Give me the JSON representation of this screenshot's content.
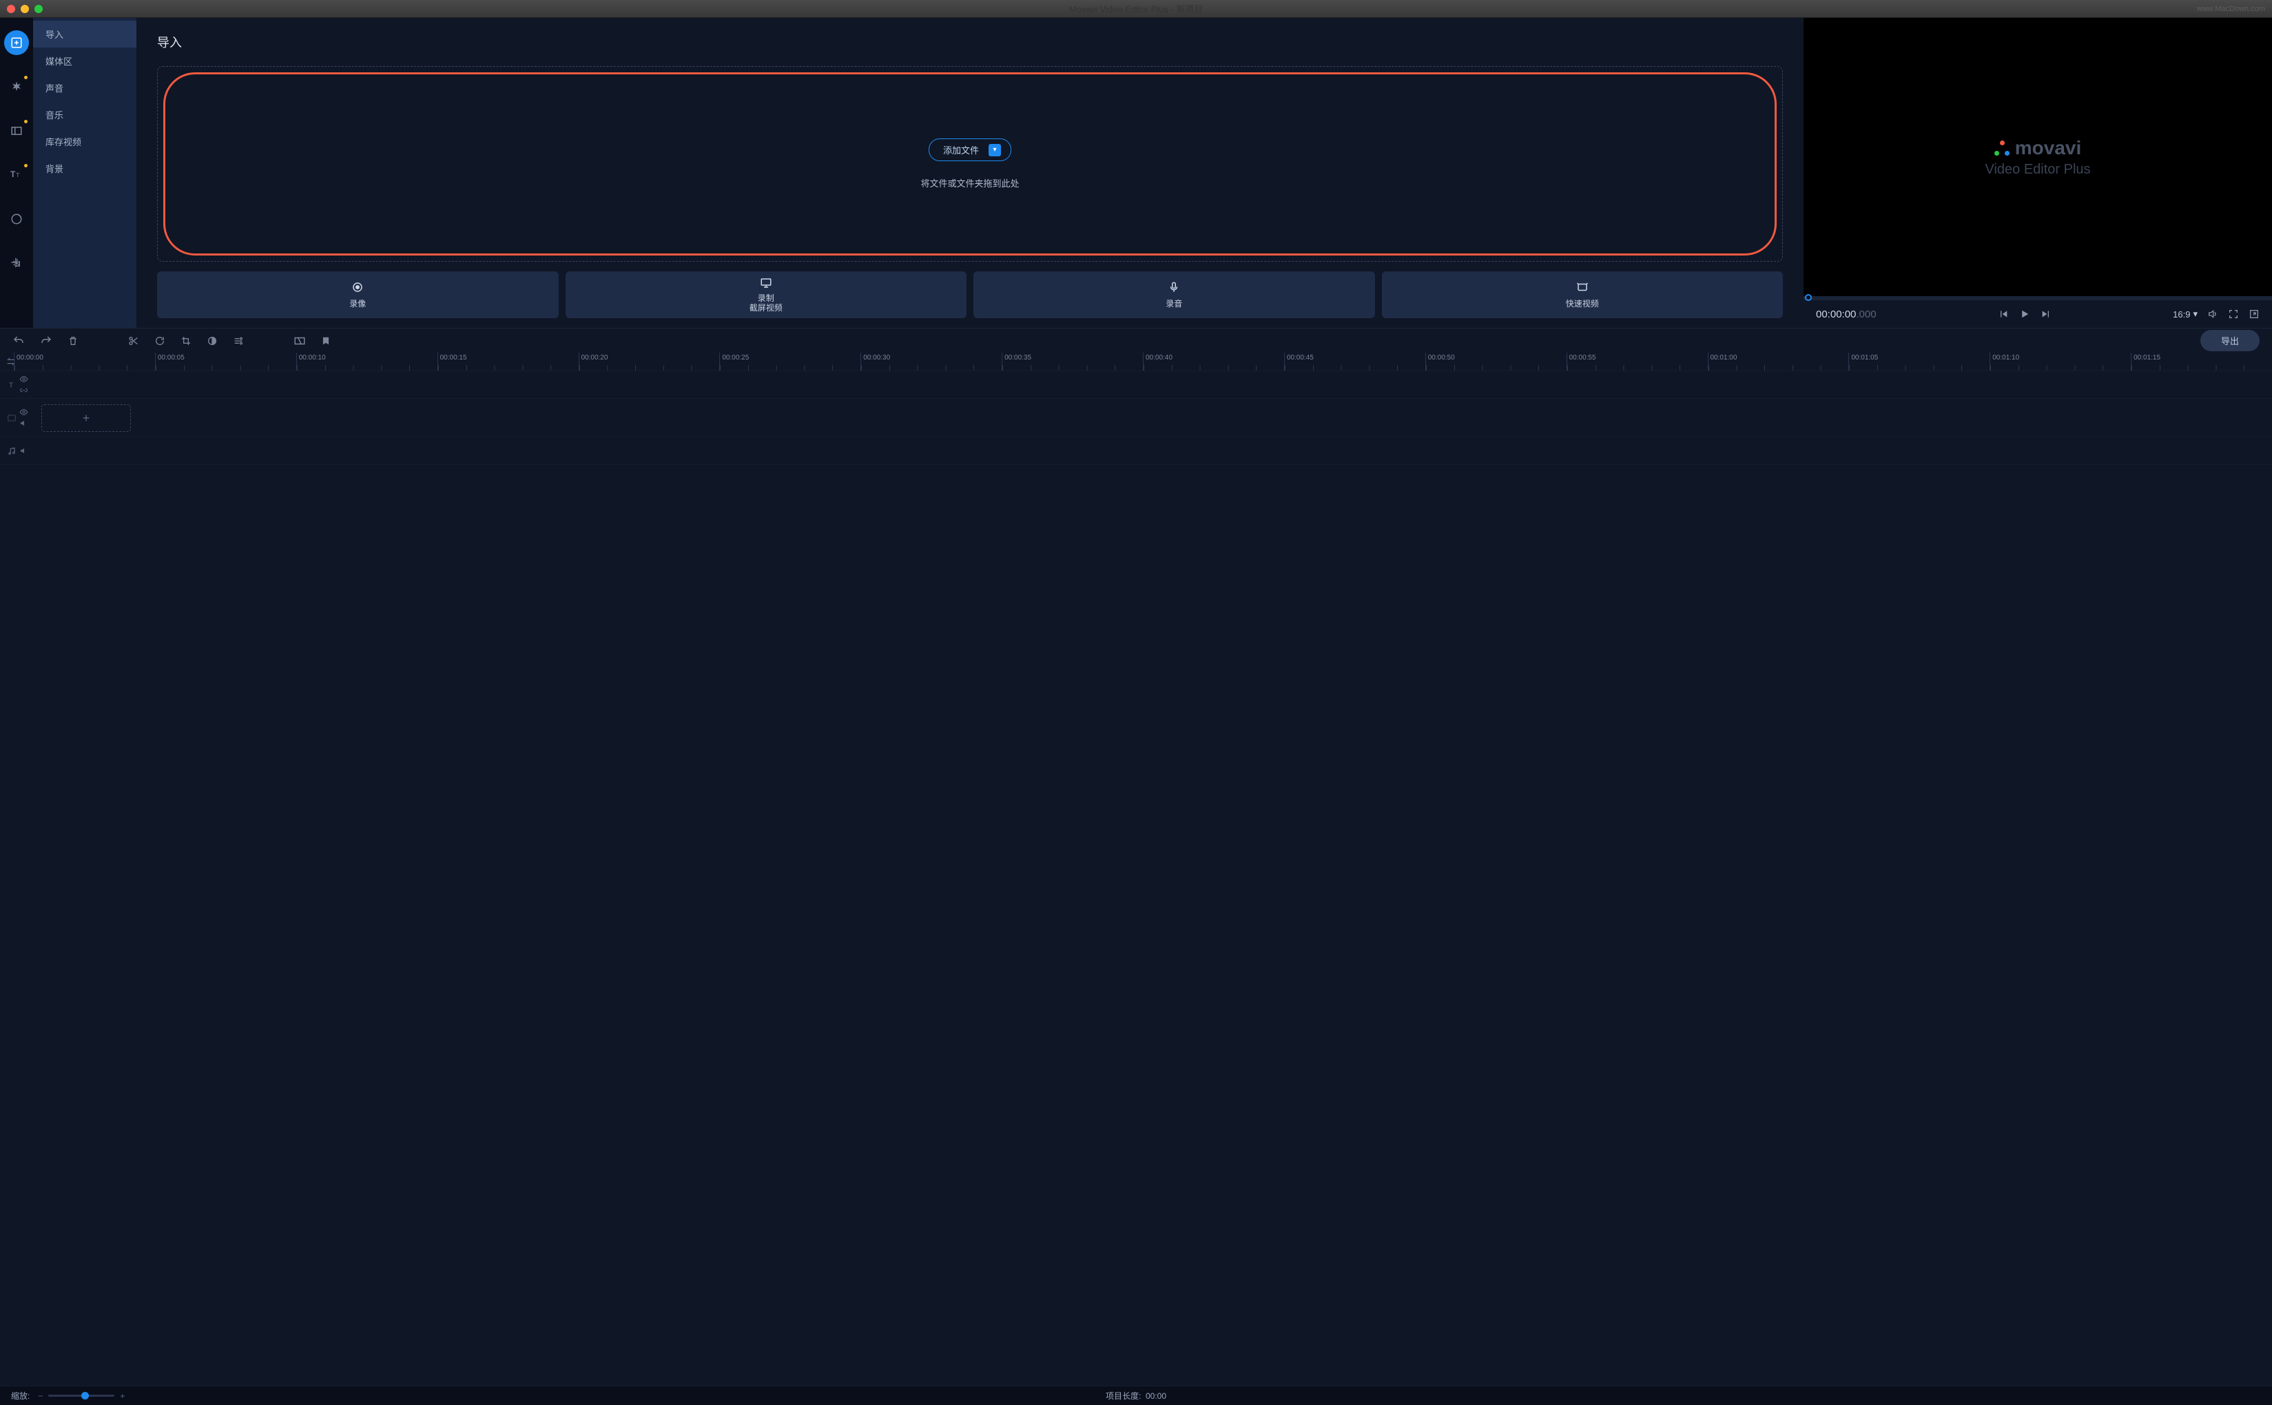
{
  "titlebar": {
    "title": "Movavi Video Editor Plus - 新项目",
    "watermark": "www.MacDown.com"
  },
  "sidebar": {
    "items": [
      "导入",
      "媒体区",
      "声音",
      "音乐",
      "库存视频",
      "背景"
    ],
    "active_index": 0
  },
  "import_pane": {
    "heading": "导入",
    "add_files_label": "添加文件",
    "drop_hint": "将文件或文件夹拖到此处",
    "capture": {
      "record_camera": "录像",
      "record_screen_l1": "录制",
      "record_screen_l2": "截屏视频",
      "record_audio": "录音",
      "fast_video": "快速视频"
    }
  },
  "preview": {
    "brand": "movavi",
    "brand_sub": "Video Editor Plus",
    "time_main": "00:00:00",
    "time_ms": ".000",
    "aspect": "16:9"
  },
  "toolbar": {
    "export_label": "导出"
  },
  "ruler": {
    "ticks": [
      "00:00:00",
      "00:00:05",
      "00:00:10",
      "00:00:15",
      "00:00:20",
      "00:00:25",
      "00:00:30",
      "00:00:35",
      "00:00:40",
      "00:00:45",
      "00:00:50",
      "00:00:55",
      "00:01:00",
      "00:01:05",
      "00:01:10",
      "00:01:15"
    ]
  },
  "timeline": {
    "add_track_plus": "+"
  },
  "statusbar": {
    "zoom_label": "缩放:",
    "length_label": "项目长度:",
    "length_value": "00:00"
  }
}
